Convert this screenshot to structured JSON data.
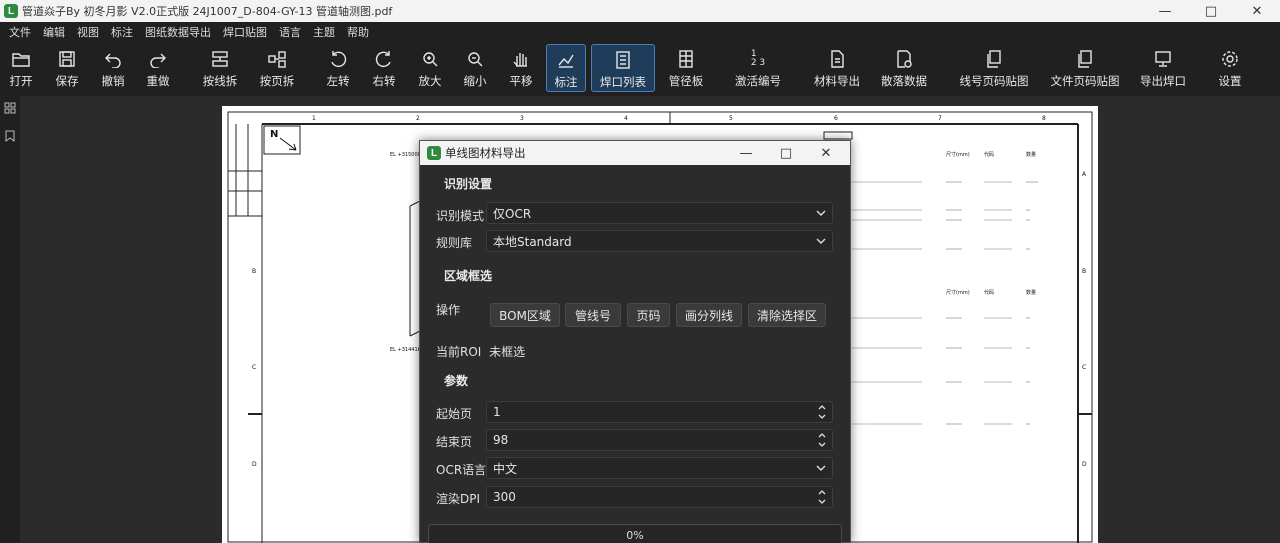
{
  "window": {
    "title": "管道焱子By 初冬月影 V2.0正式版   24J1007_D-804-GY-13 管道轴测图.pdf",
    "app_glyph": "L"
  },
  "menu": [
    "文件",
    "编辑",
    "视图",
    "标注",
    "图纸数据导出",
    "焊口贴图",
    "语言",
    "主题",
    "帮助"
  ],
  "toolbar": {
    "open": "打开",
    "save": "保存",
    "undo": "撤销",
    "redo": "重做",
    "split_line": "按线拆",
    "split_page": "按页拆",
    "rotate_left": "左转",
    "rotate_right": "右转",
    "zoom_in": "放大",
    "zoom_out": "缩小",
    "pan": "平移",
    "annotate": "标注",
    "weld_list": "焊口列表",
    "pipe_board": "管径板",
    "activate_numbering": "激活编号",
    "material_export": "材料导出",
    "scatter_data": "散落数据",
    "line_page_paste": "线号页码贴图",
    "file_page_paste": "文件页码贴图",
    "export_weld": "导出焊口",
    "settings": "设置"
  },
  "sheet": {
    "columns": [
      "1",
      "2",
      "3",
      "4",
      "5",
      "6",
      "7",
      "8"
    ],
    "rows": [
      "A",
      "B",
      "C",
      "D"
    ],
    "north": "N",
    "elev_top": "EL +315000",
    "elev_bottom": "EL +314416",
    "header_cols": [
      "尺寸(mm)",
      "代码",
      "数量"
    ]
  },
  "dialog": {
    "title": "单线图材料导出",
    "sec_recognition": "识别设置",
    "mode_label": "识别模式",
    "mode_value": "仅OCR",
    "rules_label": "规则库",
    "rules_value": "本地Standard",
    "sec_region": "区域框选",
    "ops_label": "操作",
    "btn_bom": "BOM区域",
    "btn_line": "管线号",
    "btn_page": "页码",
    "btn_divide": "画分列线",
    "btn_clear": "清除选择区",
    "roi_label": "当前ROI",
    "roi_value": "未框选",
    "sec_params": "参数",
    "start_label": "起始页",
    "start_value": "1",
    "end_label": "结束页",
    "end_value": "98",
    "ocr_label": "OCR语言",
    "ocr_value": "中文",
    "dpi_label": "渲染DPI",
    "dpi_value": "300",
    "progress": "0%"
  }
}
